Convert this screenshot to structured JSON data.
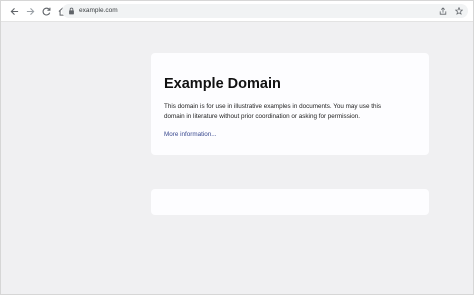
{
  "browser": {
    "url": "example.com",
    "icons": {
      "back": "arrow-left-icon",
      "forward": "arrow-right-icon",
      "reload": "reload-icon",
      "home": "home-icon",
      "lock": "lock-icon",
      "share": "share-icon",
      "bookmark": "star-icon"
    }
  },
  "page": {
    "title": "Example Domain",
    "body_line1": "This domain is for use in illustrative examples in documents. You may use this",
    "body_line2": "domain in literature without prior coordination or asking for permission.",
    "link": "More information..."
  },
  "colors": {
    "background": "#f0f0f2",
    "card": "#fdfdff",
    "link": "#38488f"
  }
}
